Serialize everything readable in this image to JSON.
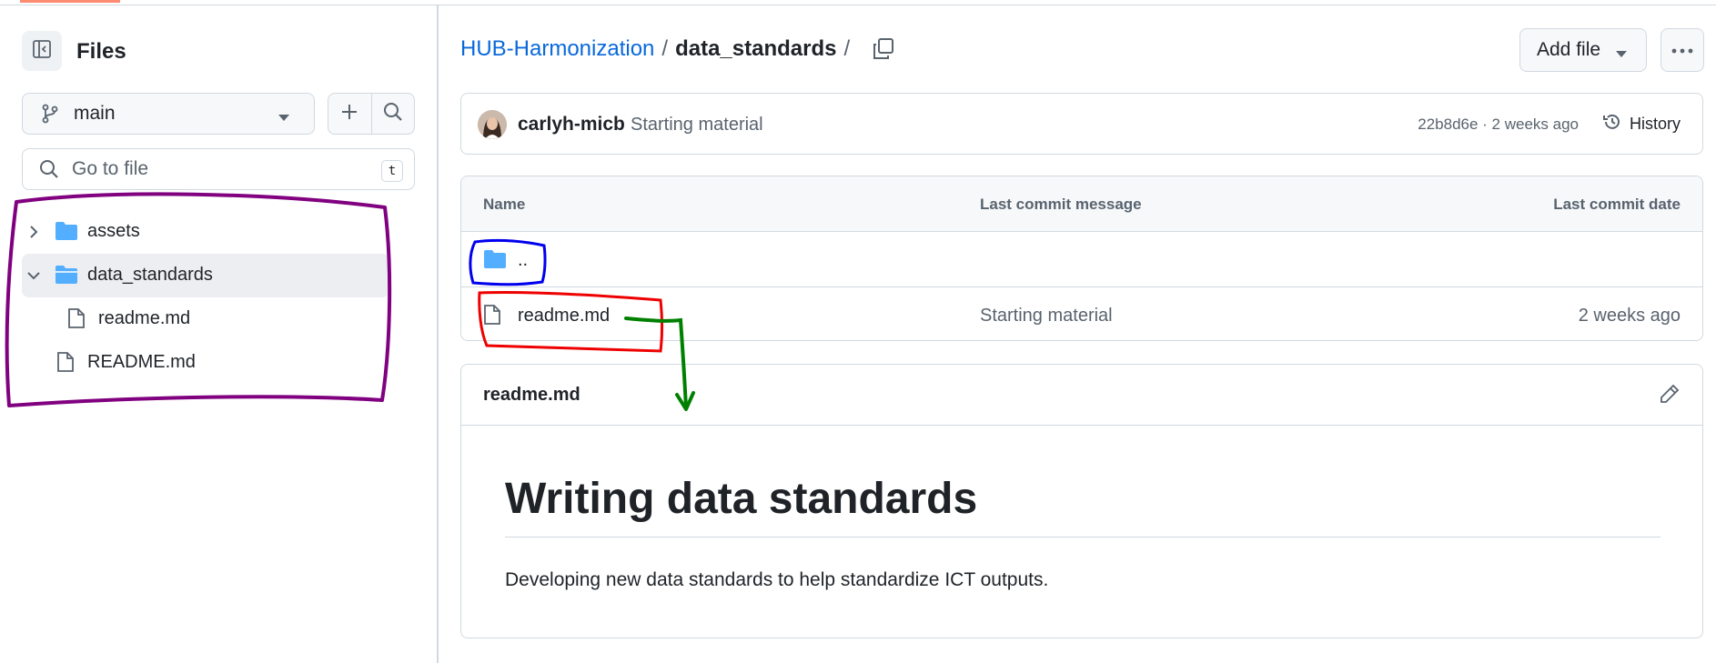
{
  "sidebar": {
    "title": "Files",
    "branch": "main",
    "search_placeholder": "Go to file",
    "search_shortcut": "t",
    "tree": [
      {
        "label": "assets",
        "type": "folder",
        "expanded": false
      },
      {
        "label": "data_standards",
        "type": "folder",
        "expanded": true,
        "active": true
      },
      {
        "label": "readme.md",
        "type": "file"
      },
      {
        "label": "README.md",
        "type": "file"
      }
    ]
  },
  "breadcrumb": {
    "repo": "HUB-Harmonization",
    "separator": "/",
    "current": "data_standards"
  },
  "toolbar": {
    "add_file_label": "Add file"
  },
  "commit": {
    "author": "carlyh-micb",
    "message": "Starting material",
    "meta": "22b8d6e · 2 weeks ago",
    "history_label": "History"
  },
  "table": {
    "headers": [
      "Name",
      "Last commit message",
      "Last commit date"
    ],
    "parent_label": "..",
    "rows": [
      {
        "name": "readme.md",
        "message": "Starting material",
        "date": "2 weeks ago"
      }
    ]
  },
  "readme": {
    "filename": "readme.md",
    "heading": "Writing data standards",
    "paragraph": "Developing new data standards to help standardize ICT outputs."
  },
  "colors": {
    "link": "#0969da",
    "folder": "#54aeff",
    "annotation_purple": "#800080",
    "annotation_blue": "#0000ee",
    "annotation_red": "#ee0000",
    "annotation_green": "#008000"
  }
}
